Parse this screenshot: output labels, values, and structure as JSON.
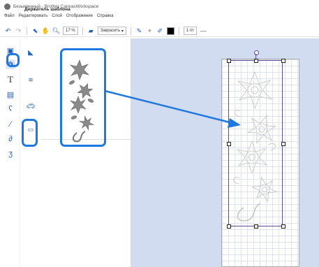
{
  "window": {
    "title": "Безымянный - Brother CanvasWorkspace"
  },
  "menu": {
    "items": [
      "Файл",
      "Редактировать",
      "Слой",
      "Отображение",
      "Справка"
    ]
  },
  "toolbar": {
    "zoom_value": "17",
    "zoom_unit": "%",
    "fill_label": "Закрасить",
    "line_width": "1",
    "line_unit": "пт",
    "swatch_color": "#000000"
  },
  "panel": {
    "title": "Держатель шаблона"
  },
  "colors": {
    "highlight": "#1f78e0",
    "canvas_bg": "#d2dcf0",
    "selection": "#5a4ba3"
  }
}
